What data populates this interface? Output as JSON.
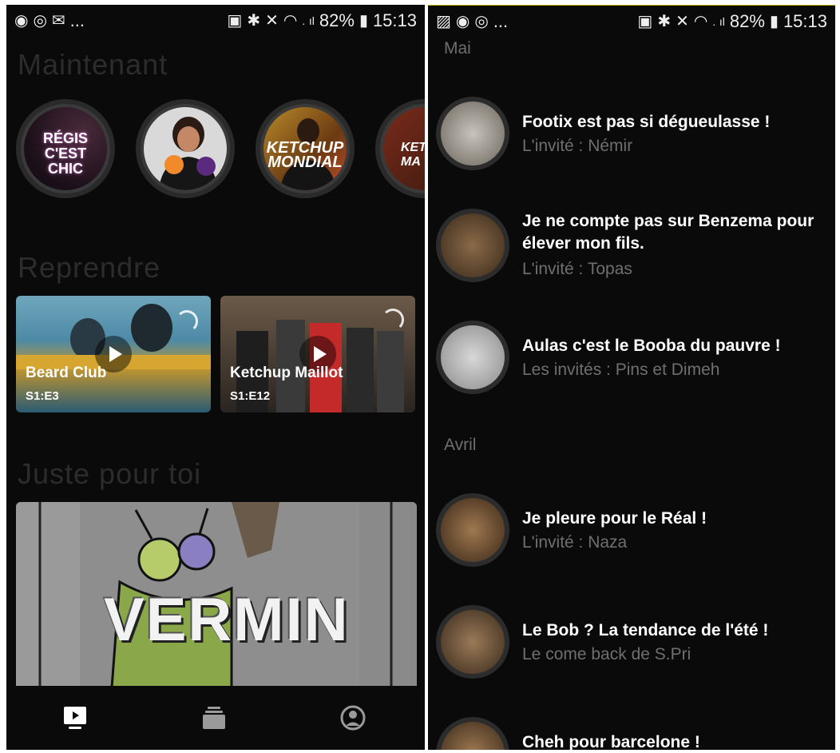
{
  "left": {
    "status": {
      "time": "15:13",
      "battery": "82%",
      "more": "...",
      "signal": ".  ıl"
    },
    "sections": {
      "now": "Maintenant",
      "resume": "Reprendre",
      "for_you": "Juste pour toi"
    },
    "shows": [
      {
        "text": "RÉGIS\nC'EST\nCHIC"
      },
      {
        "text": ""
      },
      {
        "text": "KETCHUP\nMONDIAL"
      },
      {
        "text": "KETCH\nMA"
      }
    ],
    "resume_cards": [
      {
        "title": "Beard Club",
        "episode": "S1:E3"
      },
      {
        "title": "Ketchup Maillot",
        "episode": "S1:E12"
      }
    ],
    "featured": {
      "title": "VERMIN"
    },
    "tabs": [
      "play-tab",
      "library-tab",
      "profile-tab"
    ]
  },
  "right": {
    "status": {
      "time": "15:13",
      "battery": "82%",
      "more": "...",
      "signal": ".  ıl"
    },
    "months": [
      "Mai",
      "Avril"
    ],
    "episodes": [
      {
        "title": "Footix est pas si dégueulasse !",
        "subtitle": "L'invité : Némir"
      },
      {
        "title": "Je ne compte pas sur Benzema pour élever mon fils.",
        "subtitle": "L'invité : Topas"
      },
      {
        "title": "Aulas c'est le Booba du pauvre !",
        "subtitle": "Les invités : Pins et Dimeh"
      },
      {
        "title": "Je pleure pour le Réal !",
        "subtitle": "L'invité : Naza"
      },
      {
        "title": "Le Bob ? La tendance de l'été !",
        "subtitle": "Le come back de S.Pri"
      },
      {
        "title": "Cheh pour barcelone !",
        "subtitle": ""
      }
    ]
  },
  "colors": {
    "background": "#0a0a0a",
    "muted_text": "#6f6f6f",
    "section_title": "#2c2c2c"
  }
}
